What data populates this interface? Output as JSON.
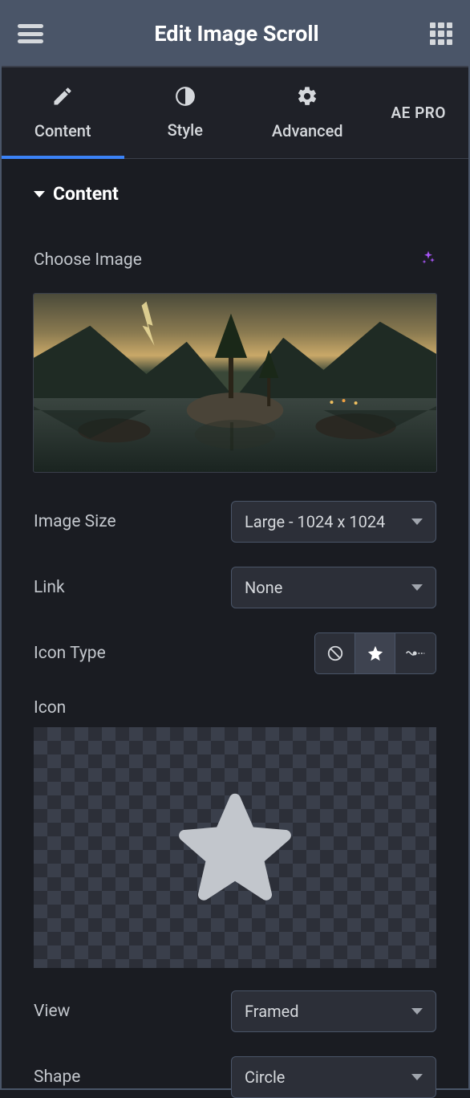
{
  "header": {
    "title": "Edit Image Scroll"
  },
  "tabs": {
    "content": "Content",
    "style": "Style",
    "advanced": "Advanced",
    "aepro": "AE PRO"
  },
  "section": {
    "title": "Content"
  },
  "fields": {
    "choose_image": "Choose Image",
    "image_size_label": "Image Size",
    "image_size_value": "Large - 1024 x 1024",
    "link_label": "Link",
    "link_value": "None",
    "icon_type_label": "Icon Type",
    "icon_label": "Icon",
    "view_label": "View",
    "view_value": "Framed",
    "shape_label": "Shape",
    "shape_value": "Circle"
  },
  "icon_type_options": {
    "none": "none-icon",
    "icon": "star-icon",
    "lottie": "lottie-icon",
    "selected": "icon"
  }
}
